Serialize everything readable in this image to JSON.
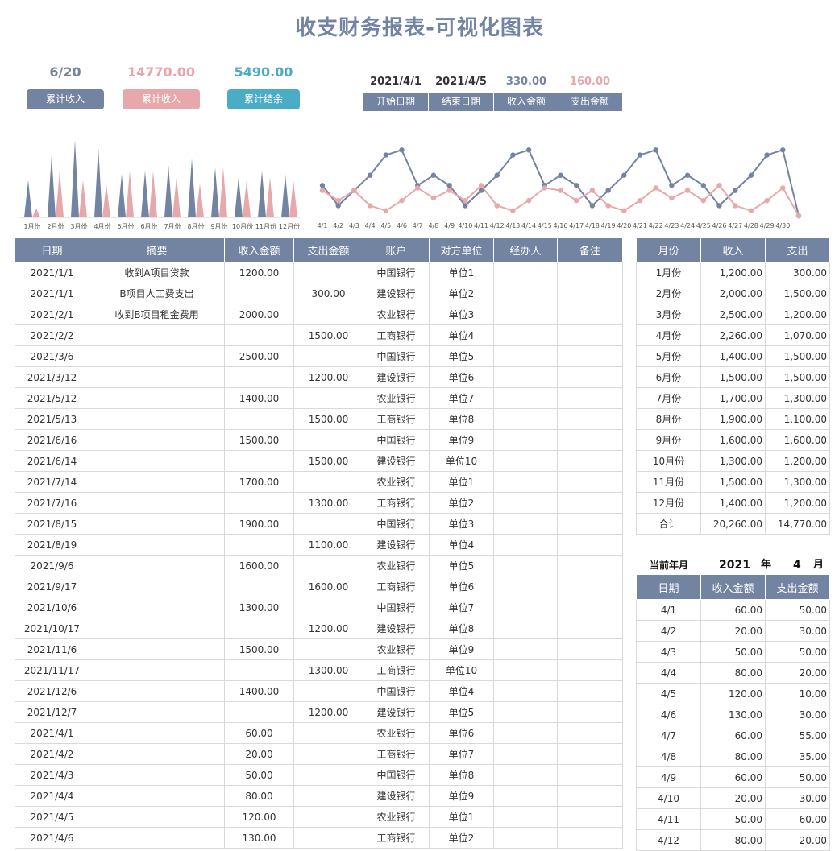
{
  "title": "收支财务报表-可视化图表",
  "kpis": [
    {
      "value": "6/20",
      "label": "累计收入",
      "color": "#7383a2"
    },
    {
      "value": "14770.00",
      "label": "累计收入",
      "color": "#e6a8ab"
    },
    {
      "value": "5490.00",
      "label": "累计结余",
      "color": "#4bacc6"
    }
  ],
  "filters": [
    {
      "value": "2021/4/1",
      "label": "开始日期",
      "color": "#333333"
    },
    {
      "value": "2021/4/5",
      "label": "结束日期",
      "color": "#333333"
    },
    {
      "value": "330.00",
      "label": "收入金额",
      "color": "#7383a2"
    },
    {
      "value": "160.00",
      "label": "支出金额",
      "color": "#e6a8ab"
    }
  ],
  "colors": {
    "income": "#7383a2",
    "expense": "#e6a8ab",
    "header": "#7383a2",
    "balance": "#4bacc6"
  },
  "chart_data": [
    {
      "type": "bar",
      "categories": [
        "1月份",
        "2月份",
        "3月份",
        "4月份",
        "5月份",
        "6月份",
        "7月份",
        "8月份",
        "9月份",
        "10月份",
        "11月份",
        "12月份"
      ],
      "series": [
        {
          "values": [
            1200,
            2000,
            2500,
            2260,
            1400,
            1500,
            1700,
            1900,
            1600,
            1300,
            1500,
            1400
          ],
          "color": "#7383a2"
        },
        {
          "values": [
            300,
            1500,
            1200,
            1070,
            1500,
            1500,
            1300,
            1100,
            1600,
            1200,
            1300,
            1200
          ],
          "color": "#e6a8ab"
        }
      ],
      "ylim": [
        0,
        2600
      ],
      "grid": false
    },
    {
      "type": "line",
      "categories": [
        "4/1",
        "4/2",
        "4/3",
        "4/4",
        "4/5",
        "4/6",
        "4/7",
        "4/8",
        "4/9",
        "4/10",
        "4/11",
        "4/12",
        "4/13",
        "4/14",
        "4/15",
        "4/16",
        "4/17",
        "4/18",
        "4/19",
        "4/20",
        "4/21",
        "4/22",
        "4/23",
        "4/24",
        "4/25",
        "4/26",
        "4/27",
        "4/28",
        "4/29",
        "4/30"
      ],
      "series": [
        {
          "values": [
            60,
            20,
            50,
            80,
            120,
            130,
            60,
            80,
            60,
            20,
            50,
            80,
            120,
            130,
            60,
            80,
            60,
            20,
            50,
            80,
            120,
            130,
            60,
            80,
            60,
            20,
            50,
            80,
            120,
            130,
            0
          ],
          "color": "#7383a2"
        },
        {
          "values": [
            50,
            30,
            50,
            20,
            10,
            30,
            55,
            35,
            50,
            30,
            60,
            20,
            10,
            30,
            55,
            50,
            30,
            50,
            20,
            10,
            30,
            55,
            35,
            50,
            30,
            60,
            20,
            10,
            30,
            55,
            0
          ],
          "color": "#e6a8ab"
        }
      ],
      "ylim": [
        0,
        140
      ],
      "grid": false
    }
  ],
  "main_table": {
    "headers": [
      "日期",
      "摘要",
      "收入金额",
      "支出金额",
      "账户",
      "对方单位",
      "经办人",
      "备注"
    ],
    "rows": [
      [
        "2021/1/1",
        "收到A项目贷款",
        "1200.00",
        "",
        "中国银行",
        "单位1",
        "",
        ""
      ],
      [
        "2021/1/1",
        "B项目人工费支出",
        "",
        "300.00",
        "建设银行",
        "单位2",
        "",
        ""
      ],
      [
        "2021/2/1",
        "收到B项目租金费用",
        "2000.00",
        "",
        "农业银行",
        "单位3",
        "",
        ""
      ],
      [
        "2021/2/2",
        "",
        "",
        "1500.00",
        "工商银行",
        "单位4",
        "",
        ""
      ],
      [
        "2021/3/6",
        "",
        "2500.00",
        "",
        "中国银行",
        "单位5",
        "",
        ""
      ],
      [
        "2021/3/12",
        "",
        "",
        "1200.00",
        "建设银行",
        "单位6",
        "",
        ""
      ],
      [
        "2021/5/12",
        "",
        "1400.00",
        "",
        "农业银行",
        "单位7",
        "",
        ""
      ],
      [
        "2021/5/13",
        "",
        "",
        "1500.00",
        "工商银行",
        "单位8",
        "",
        ""
      ],
      [
        "2021/6/16",
        "",
        "1500.00",
        "",
        "中国银行",
        "单位9",
        "",
        ""
      ],
      [
        "2021/6/14",
        "",
        "",
        "1500.00",
        "建设银行",
        "单位10",
        "",
        ""
      ],
      [
        "2021/7/14",
        "",
        "1700.00",
        "",
        "农业银行",
        "单位1",
        "",
        ""
      ],
      [
        "2021/7/16",
        "",
        "",
        "1300.00",
        "工商银行",
        "单位2",
        "",
        ""
      ],
      [
        "2021/8/15",
        "",
        "1900.00",
        "",
        "中国银行",
        "单位3",
        "",
        ""
      ],
      [
        "2021/8/19",
        "",
        "",
        "1100.00",
        "建设银行",
        "单位4",
        "",
        ""
      ],
      [
        "2021/9/6",
        "",
        "1600.00",
        "",
        "农业银行",
        "单位5",
        "",
        ""
      ],
      [
        "2021/9/17",
        "",
        "",
        "1600.00",
        "工商银行",
        "单位6",
        "",
        ""
      ],
      [
        "2021/10/6",
        "",
        "1300.00",
        "",
        "中国银行",
        "单位7",
        "",
        ""
      ],
      [
        "2021/10/17",
        "",
        "",
        "1200.00",
        "建设银行",
        "单位8",
        "",
        ""
      ],
      [
        "2021/11/6",
        "",
        "1500.00",
        "",
        "农业银行",
        "单位9",
        "",
        ""
      ],
      [
        "2021/11/17",
        "",
        "",
        "1300.00",
        "工商银行",
        "单位10",
        "",
        ""
      ],
      [
        "2021/12/6",
        "",
        "1400.00",
        "",
        "中国银行",
        "单位4",
        "",
        ""
      ],
      [
        "2021/12/7",
        "",
        "",
        "1200.00",
        "建设银行",
        "单位5",
        "",
        ""
      ],
      [
        "2021/4/1",
        "",
        "60.00",
        "",
        "农业银行",
        "单位6",
        "",
        ""
      ],
      [
        "2021/4/2",
        "",
        "20.00",
        "",
        "工商银行",
        "单位7",
        "",
        ""
      ],
      [
        "2021/4/3",
        "",
        "50.00",
        "",
        "中国银行",
        "单位8",
        "",
        ""
      ],
      [
        "2021/4/4",
        "",
        "80.00",
        "",
        "建设银行",
        "单位9",
        "",
        ""
      ],
      [
        "2021/4/5",
        "",
        "120.00",
        "",
        "农业银行",
        "单位1",
        "",
        ""
      ],
      [
        "2021/4/6",
        "",
        "130.00",
        "",
        "工商银行",
        "单位2",
        "",
        ""
      ]
    ]
  },
  "monthly_table": {
    "headers": [
      "月份",
      "收入",
      "支出"
    ],
    "rows": [
      [
        "1月份",
        "1,200.00",
        "300.00"
      ],
      [
        "2月份",
        "2,000.00",
        "1,500.00"
      ],
      [
        "3月份",
        "2,500.00",
        "1,200.00"
      ],
      [
        "4月份",
        "2,260.00",
        "1,070.00"
      ],
      [
        "5月份",
        "1,400.00",
        "1,500.00"
      ],
      [
        "6月份",
        "1,500.00",
        "1,500.00"
      ],
      [
        "7月份",
        "1,700.00",
        "1,300.00"
      ],
      [
        "8月份",
        "1,900.00",
        "1,100.00"
      ],
      [
        "9月份",
        "1,600.00",
        "1,600.00"
      ],
      [
        "10月份",
        "1,300.00",
        "1,200.00"
      ],
      [
        "11月份",
        "1,500.00",
        "1,300.00"
      ],
      [
        "12月份",
        "1,400.00",
        "1,200.00"
      ],
      [
        "合计",
        "20,260.00",
        "14,770.00"
      ]
    ]
  },
  "current_month": {
    "label": "当前年月",
    "year": "2021",
    "year_unit": "年",
    "month": "4",
    "month_unit": "月"
  },
  "daily_table": {
    "headers": [
      "日期",
      "收入金额",
      "支出金额"
    ],
    "rows": [
      [
        "4/1",
        "60.00",
        "50.00"
      ],
      [
        "4/2",
        "20.00",
        "30.00"
      ],
      [
        "4/3",
        "50.00",
        "50.00"
      ],
      [
        "4/4",
        "80.00",
        "20.00"
      ],
      [
        "4/5",
        "120.00",
        "10.00"
      ],
      [
        "4/6",
        "130.00",
        "30.00"
      ],
      [
        "4/7",
        "60.00",
        "55.00"
      ],
      [
        "4/8",
        "80.00",
        "35.00"
      ],
      [
        "4/9",
        "60.00",
        "50.00"
      ],
      [
        "4/10",
        "20.00",
        "30.00"
      ],
      [
        "4/11",
        "50.00",
        "60.00"
      ],
      [
        "4/12",
        "80.00",
        "20.00"
      ]
    ]
  }
}
